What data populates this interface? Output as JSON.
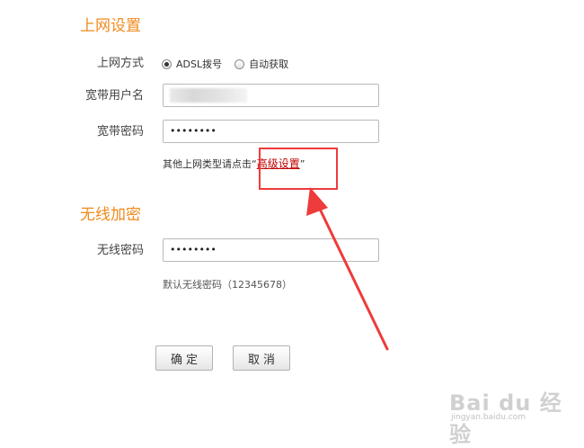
{
  "internet_settings": {
    "title": "上网设置",
    "connection_type": {
      "label": "上网方式",
      "options": [
        "ADSL拨号",
        "自动获取"
      ],
      "selected": "ADSL拨号"
    },
    "username": {
      "label": "宽带用户名",
      "value": ""
    },
    "password": {
      "label": "宽带密码",
      "value": "••••••••"
    },
    "advanced_hint": {
      "prefix": "其他上网类型请点击“",
      "link": "高级设置",
      "suffix": "”"
    }
  },
  "wireless": {
    "title": "无线加密",
    "password": {
      "label": "无线密码",
      "value": "••••••••"
    },
    "default_hint": "默认无线密码（12345678）"
  },
  "buttons": {
    "confirm": "确定",
    "cancel": "取消"
  },
  "annotation": {
    "color": "#ee3b3b"
  },
  "watermark": {
    "logo": "Bai du 经验",
    "url": "jingyan.baidu.com"
  },
  "colors": {
    "section_title": "#f08a1c",
    "link": "#c00000"
  }
}
